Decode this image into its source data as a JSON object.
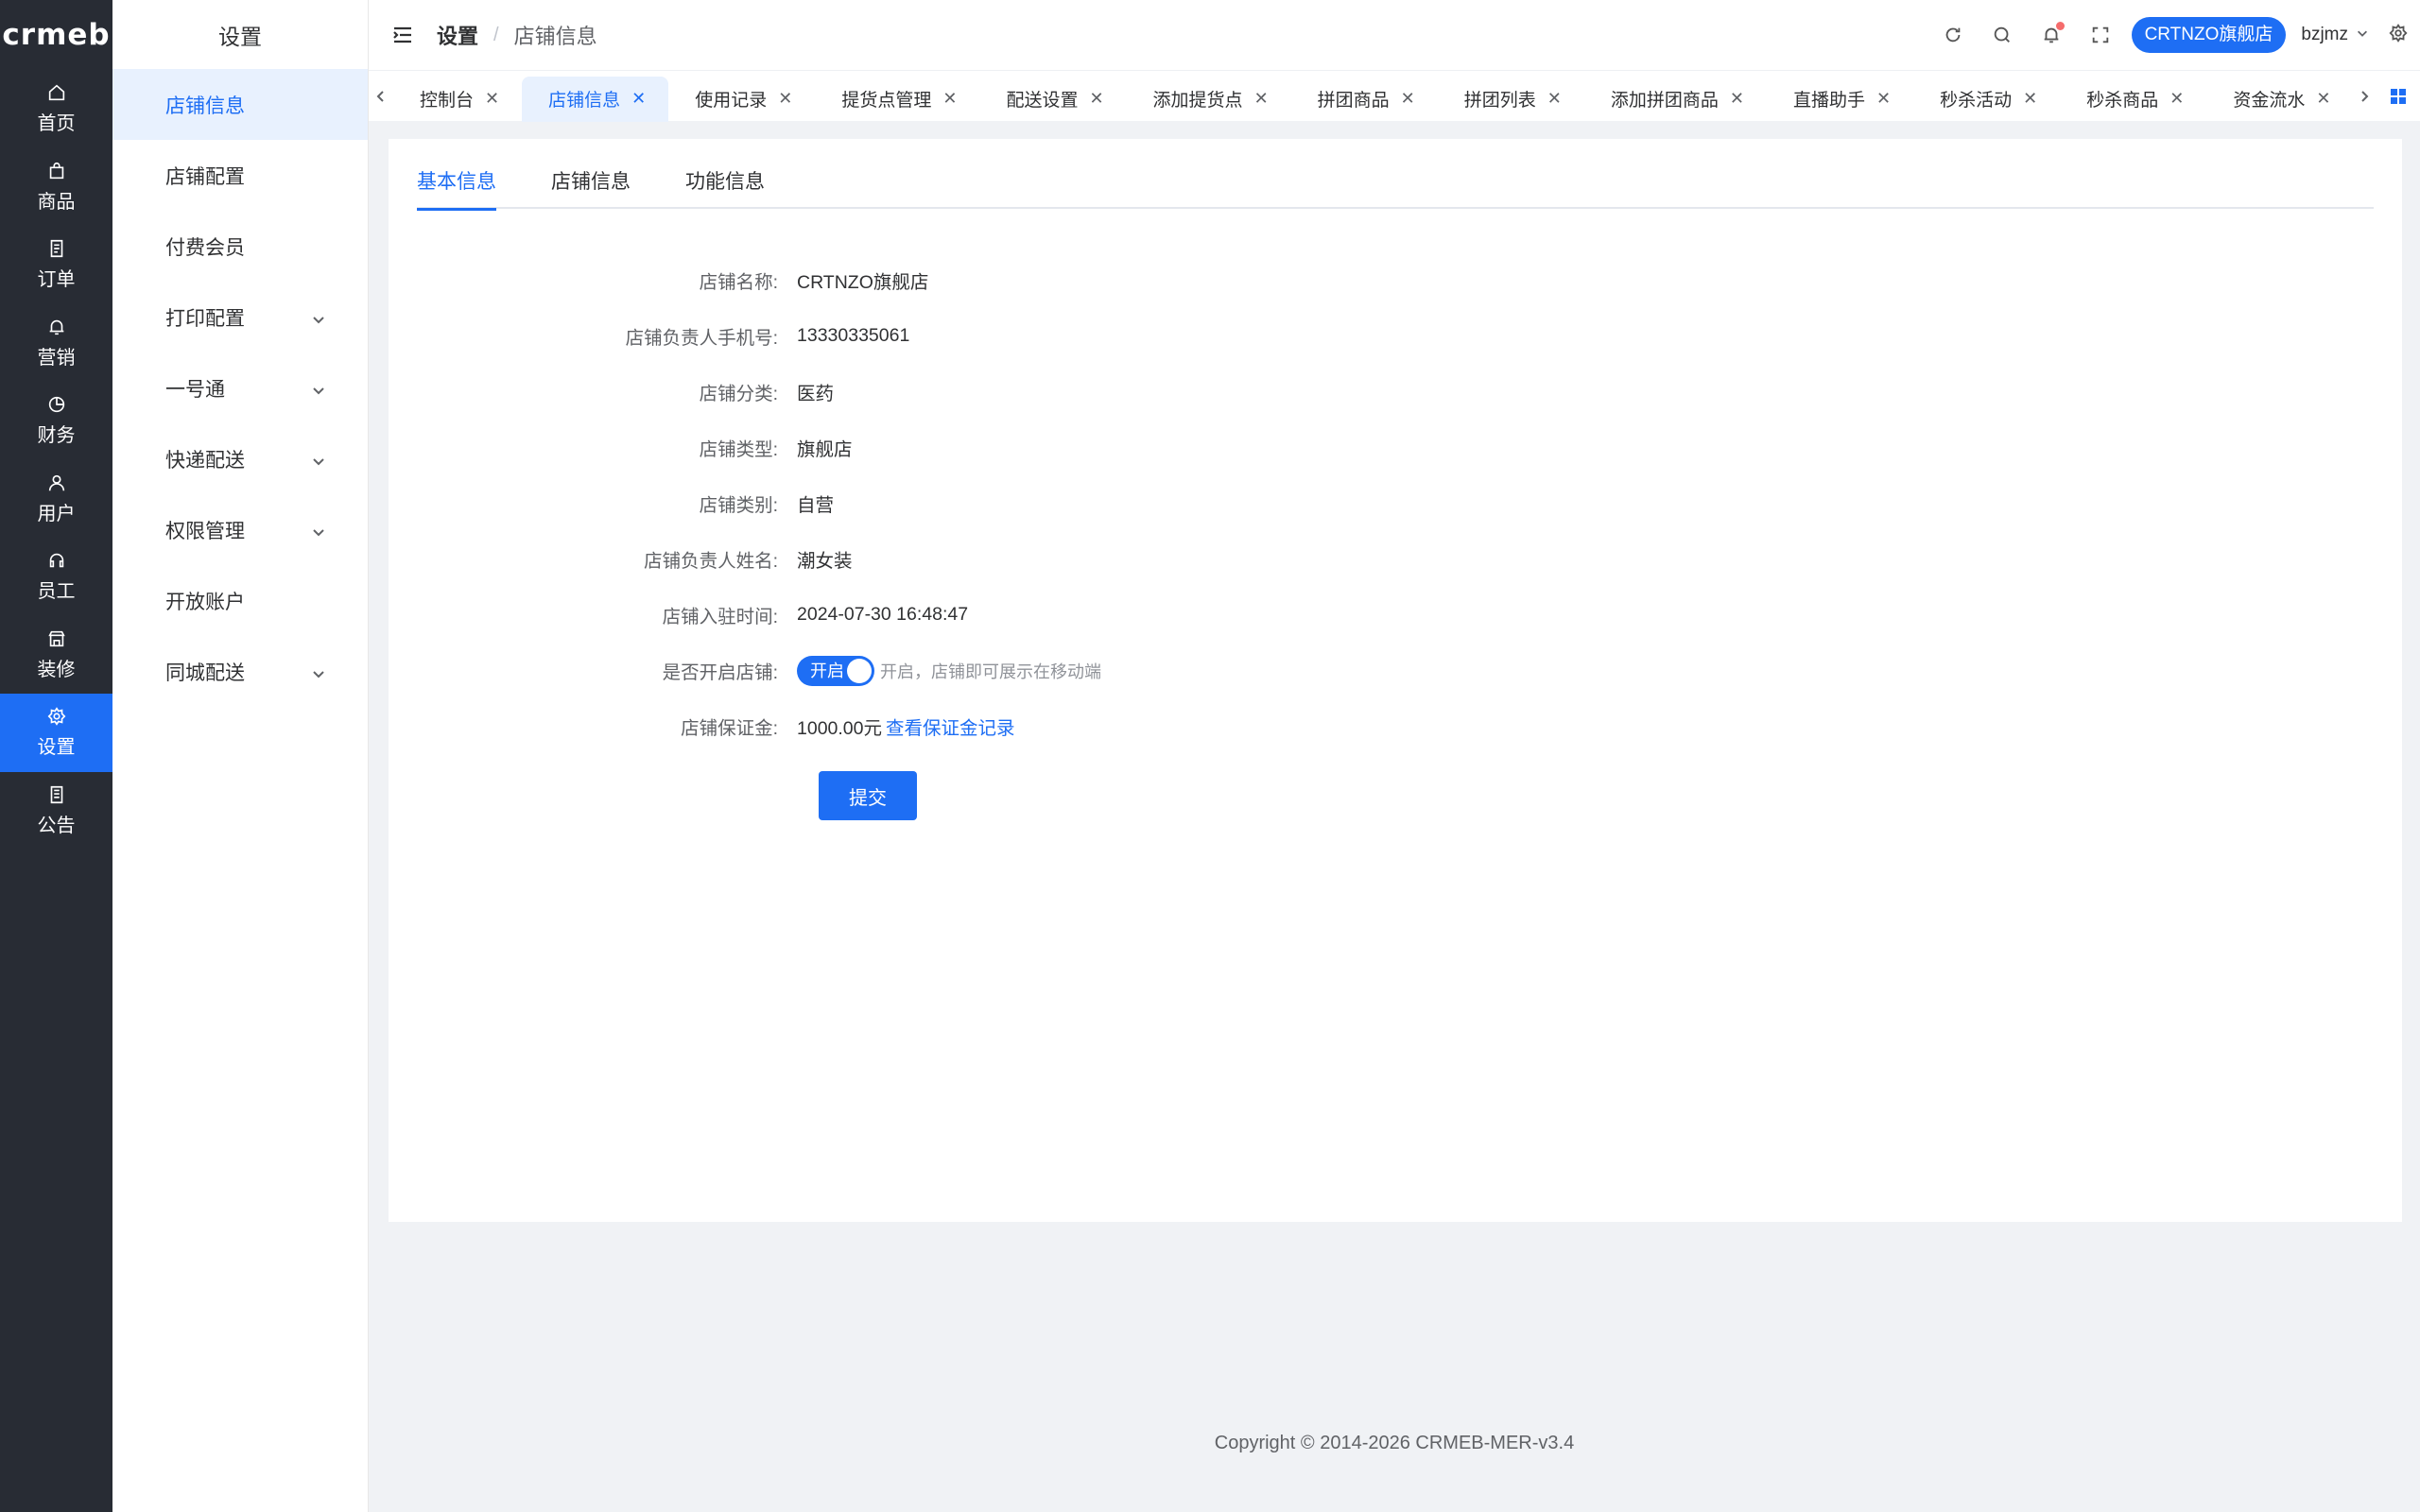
{
  "brand": {
    "logo_text": "crmeb"
  },
  "rail": {
    "items": [
      {
        "label": "首页",
        "icon": "home-icon"
      },
      {
        "label": "商品",
        "icon": "bag-icon"
      },
      {
        "label": "订单",
        "icon": "document-icon"
      },
      {
        "label": "营销",
        "icon": "bell-icon"
      },
      {
        "label": "财务",
        "icon": "pie-icon"
      },
      {
        "label": "用户",
        "icon": "user-icon"
      },
      {
        "label": "员工",
        "icon": "headset-icon"
      },
      {
        "label": "装修",
        "icon": "shop-icon"
      },
      {
        "label": "设置",
        "icon": "gear-icon",
        "active": true
      },
      {
        "label": "公告",
        "icon": "notice-icon"
      }
    ]
  },
  "submenu": {
    "title": "设置",
    "items": [
      {
        "label": "店铺信息",
        "active": true
      },
      {
        "label": "店铺配置"
      },
      {
        "label": "付费会员"
      },
      {
        "label": "打印配置",
        "expandable": true
      },
      {
        "label": "一号通",
        "expandable": true
      },
      {
        "label": "快递配送",
        "expandable": true
      },
      {
        "label": "权限管理",
        "expandable": true
      },
      {
        "label": "开放账户"
      },
      {
        "label": "同城配送",
        "expandable": true
      }
    ]
  },
  "header": {
    "breadcrumb_section": "设置",
    "breadcrumb_separator": "/",
    "breadcrumb_page": "店铺信息",
    "store_button": "CRTNZO旗舰店",
    "username": "bzjmz"
  },
  "tags": [
    {
      "label": "控制台"
    },
    {
      "label": "店铺信息",
      "active": true
    },
    {
      "label": "使用记录"
    },
    {
      "label": "提货点管理"
    },
    {
      "label": "配送设置"
    },
    {
      "label": "添加提货点"
    },
    {
      "label": "拼团商品"
    },
    {
      "label": "拼团列表"
    },
    {
      "label": "添加拼团商品"
    },
    {
      "label": "直播助手"
    },
    {
      "label": "秒杀活动"
    },
    {
      "label": "秒杀商品"
    },
    {
      "label": "资金流水"
    }
  ],
  "content": {
    "tabs": [
      "基本信息",
      "店铺信息",
      "功能信息"
    ],
    "active_tab": 0,
    "fields": [
      {
        "label": "店铺名称:",
        "value": "CRTNZO旗舰店"
      },
      {
        "label": "店铺负责人手机号:",
        "value": "13330335061"
      },
      {
        "label": "店铺分类:",
        "value": "医药"
      },
      {
        "label": "店铺类型:",
        "value": "旗舰店"
      },
      {
        "label": "店铺类别:",
        "value": "自营"
      },
      {
        "label": "店铺负责人姓名:",
        "value": "潮女装"
      },
      {
        "label": "店铺入驻时间:",
        "value": "2024-07-30 16:48:47"
      }
    ],
    "open_store": {
      "label": "是否开启店铺:",
      "switch_text": "开启",
      "hint": "开启，店铺即可展示在移动端"
    },
    "deposit": {
      "label": "店铺保证金:",
      "value": "1000.00元",
      "link": "查看保证金记录"
    },
    "submit_label": "提交"
  },
  "footer": {
    "copyright": "Copyright © 2014-2026 CRMEB-MER-v3.4"
  },
  "colors": {
    "primary": "#1e6ef4",
    "rail_bg": "#282c34",
    "page_bg": "#f0f2f5"
  }
}
